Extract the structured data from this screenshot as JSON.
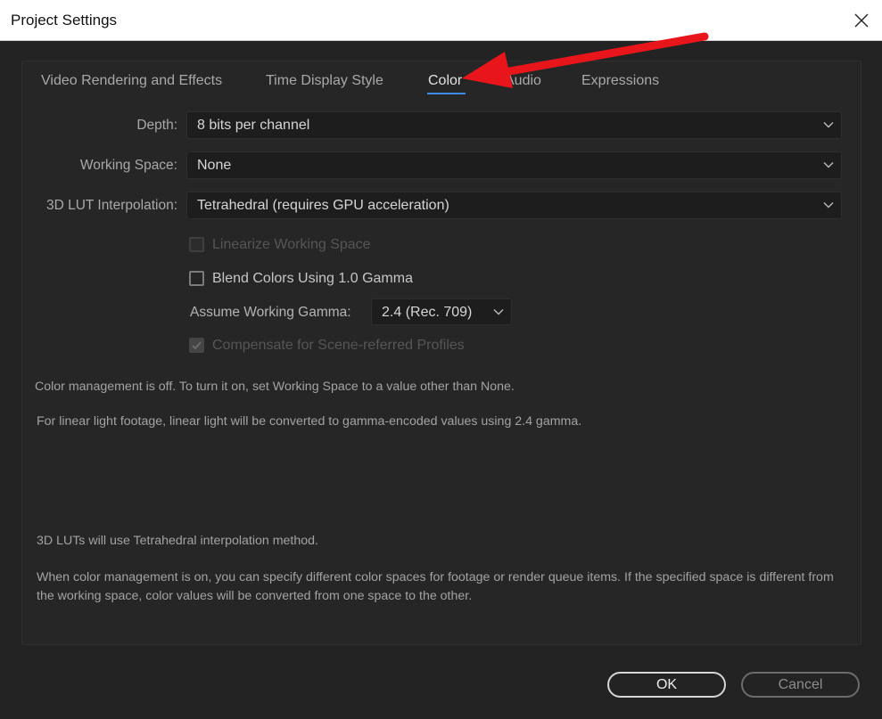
{
  "window": {
    "title": "Project Settings"
  },
  "tabs": [
    {
      "label": "Video Rendering and Effects",
      "active": false
    },
    {
      "label": "Time Display Style",
      "active": false
    },
    {
      "label": "Color",
      "active": true
    },
    {
      "label": "Audio",
      "active": false
    },
    {
      "label": "Expressions",
      "active": false
    }
  ],
  "form": {
    "depth": {
      "label": "Depth:",
      "value": "8 bits per channel"
    },
    "working_space": {
      "label": "Working Space:",
      "value": "None"
    },
    "lut_interpolation": {
      "label": "3D LUT Interpolation:",
      "value": "Tetrahedral (requires GPU acceleration)"
    },
    "linearize": {
      "label": "Linearize Working Space",
      "checked": false,
      "enabled": false
    },
    "blend_gamma": {
      "label": "Blend Colors Using 1.0 Gamma",
      "checked": false,
      "enabled": true
    },
    "assume_gamma": {
      "label": "Assume Working Gamma:",
      "value": "2.4 (Rec. 709)"
    },
    "compensate": {
      "label": "Compensate for Scene-referred Profiles",
      "checked": true,
      "enabled": false
    }
  },
  "info": {
    "color_management": "Color management is off. To turn it on, set Working Space to a value other than None.",
    "linear_light": "For linear light footage, linear light will be converted to gamma-encoded values using 2.4 gamma.",
    "lut_method": "3D LUTs will use Tetrahedral interpolation method.",
    "color_spaces": "When color management is on, you can specify different color spaces for footage or render queue items. If the specified space is different from the working space, color values will be converted from one space to the other."
  },
  "buttons": {
    "ok": "OK",
    "cancel": "Cancel"
  },
  "icons": {
    "close": "close-icon",
    "dropdown": "chevron-down-icon",
    "checkmark": "checkmark-icon",
    "annotation": "red-arrow-annotation"
  },
  "colors": {
    "background": "#232323",
    "accent": "#3c8ce7",
    "annotation_arrow": "#e8161b"
  }
}
